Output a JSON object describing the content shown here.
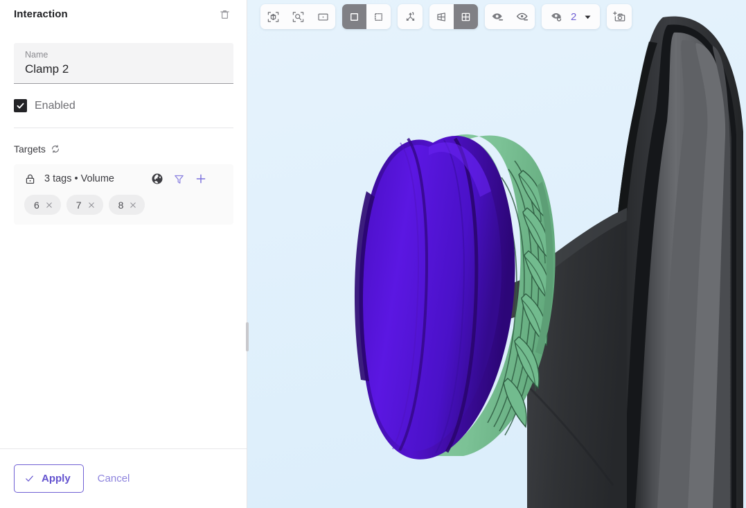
{
  "panel": {
    "title": "Interaction",
    "delete_icon": "trash-icon",
    "name_field": {
      "label": "Name",
      "value": "Clamp 2"
    },
    "enabled": {
      "label": "Enabled",
      "checked": true
    },
    "targets": {
      "title": "Targets",
      "refresh_icon": "refresh-icon",
      "lock_icon": "lock-icon",
      "summary": "3 tags • Volume",
      "globe_icon": "globe-icon",
      "filter_icon": "filter-icon",
      "add_icon": "plus-icon",
      "chips": [
        {
          "label": "6",
          "remove": "×"
        },
        {
          "label": "7",
          "remove": "×"
        },
        {
          "label": "8",
          "remove": "×"
        }
      ]
    },
    "footer": {
      "apply_label": "Apply",
      "cancel_label": "Cancel"
    }
  },
  "viewport": {
    "background": "#e1f0fb",
    "toolbar": {
      "group_view": [
        {
          "name": "fit-to-view-icon",
          "active": false
        },
        {
          "name": "zoom-to-selection-icon",
          "active": false
        },
        {
          "name": "fit-to-screen-icon",
          "active": false
        }
      ],
      "group_select": [
        {
          "name": "solid-box-select-icon",
          "active": true
        },
        {
          "name": "dashed-box-select-icon",
          "active": false
        }
      ],
      "axes": {
        "name": "axes-orientation-icon",
        "active": false
      },
      "group_layout": [
        {
          "name": "perspective-grid-icon",
          "active": false
        },
        {
          "name": "quad-grid-icon",
          "active": true
        }
      ],
      "group_visibility": [
        {
          "name": "eye-hide-icon",
          "active": false
        },
        {
          "name": "eye-show-icon",
          "active": false
        }
      ],
      "view_dropdown": {
        "icon": "eye-refresh-icon",
        "value": "2",
        "caret": "chevron-down-icon"
      },
      "camera": {
        "name": "add-camera-icon"
      }
    },
    "model_colors": {
      "violet": "#5b18d8",
      "violet_dark": "#3a0ba0",
      "green": "#7fc79b",
      "green_dark": "#5fa87c",
      "gray": "#5b5d61",
      "gray_dark": "#2e3033"
    }
  }
}
